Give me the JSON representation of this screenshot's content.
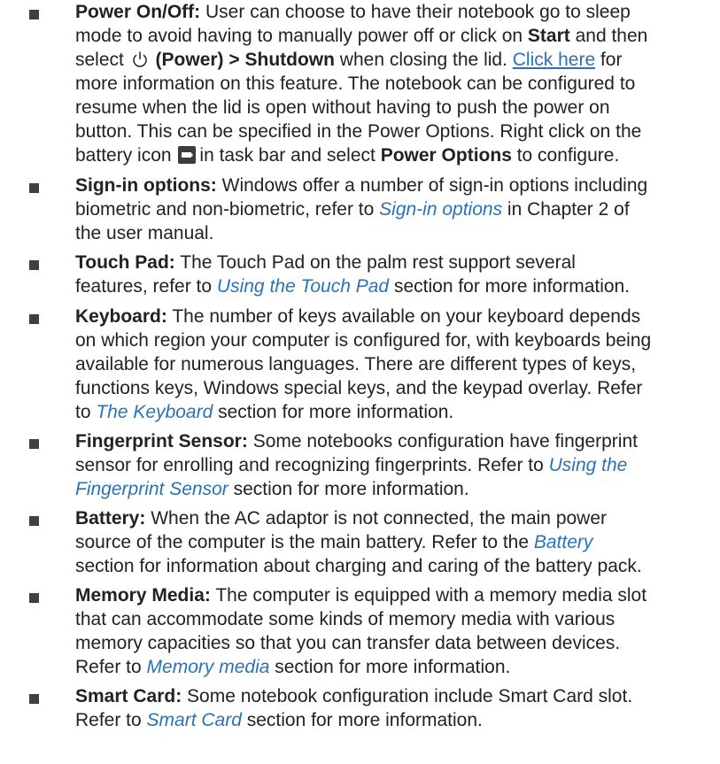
{
  "items": [
    {
      "title": "Power On/Off:",
      "l1": "User can choose to have their notebook go to sleep",
      "l2a": "mode to avoid having to manually power off or click on ",
      "l2b": "Start",
      "l2c": " and then",
      "l3a": "select ",
      "l3b": "(Power) > Shutdown",
      "l3c": " when closing the lid. ",
      "l3link": "Click here",
      "l3d": " for",
      "l4": "more information on this feature. The notebook can be configured to",
      "l5": "resume when the lid is open without having to push the power on",
      "l6": "button. This can be specified in the Power Options. Right click on the",
      "l7a": "battery icon",
      "l7b": "in task bar and select ",
      "l7c": "Power Options",
      "l7d": " to configure."
    },
    {
      "title": "Sign-in options:",
      "l1": "Windows offer a number of sign-in options including",
      "l2": "biometric and non-biometric, refer to ",
      "ref": "Sign-in options",
      "l2b": " in Chapter 2 of",
      "l3": "the user manual."
    },
    {
      "title": "Touch Pad:",
      "l1": "The Touch Pad on the palm rest support several",
      "l2a": "features, refer to ",
      "ref": "Using the Touch Pad",
      "l2b": " section for more information."
    },
    {
      "title": "Keyboard:",
      "l1": "The number of keys available on your keyboard depends",
      "l2": "on which region your computer is configured for, with keyboards being",
      "l3": "available for numerous languages. There are different types of keys,",
      "l4": "functions keys, Windows special keys, and the keypad overlay. Refer",
      "l5a": "to ",
      "ref": "The Keyboard",
      "l5b": " section for more information."
    },
    {
      "title": "Fingerprint Sensor:",
      "l1": "Some notebooks configuration have fingerprint",
      "l2a": "sensor for enrolling and recognizing fingerprints. Refer to ",
      "ref1": "Using the",
      "ref2": "Fingerprint Sensor",
      "l3b": " section for more information."
    },
    {
      "title": "Battery:",
      "l1": "When the AC adaptor is not connected, the main power",
      "l2a": "source of the computer is the main battery. Refer to the ",
      "ref": "Battery",
      "l3": "section for information about charging and caring of the battery pack."
    },
    {
      "title": "Memory Media:",
      "l1": "The computer is equipped with a memory media slot",
      "l2": "that can accommodate some kinds of memory media with various",
      "l3": "memory capacities so that you can transfer data between devices.",
      "l4a": "Refer to ",
      "ref": "Memory media",
      "l4b": " section for more information."
    },
    {
      "title": "Smart Card:",
      "l1": "Some notebook configuration include Smart Card slot.",
      "l2a": "Refer to ",
      "ref": "Smart Card",
      "l2b": " section for more information."
    }
  ]
}
